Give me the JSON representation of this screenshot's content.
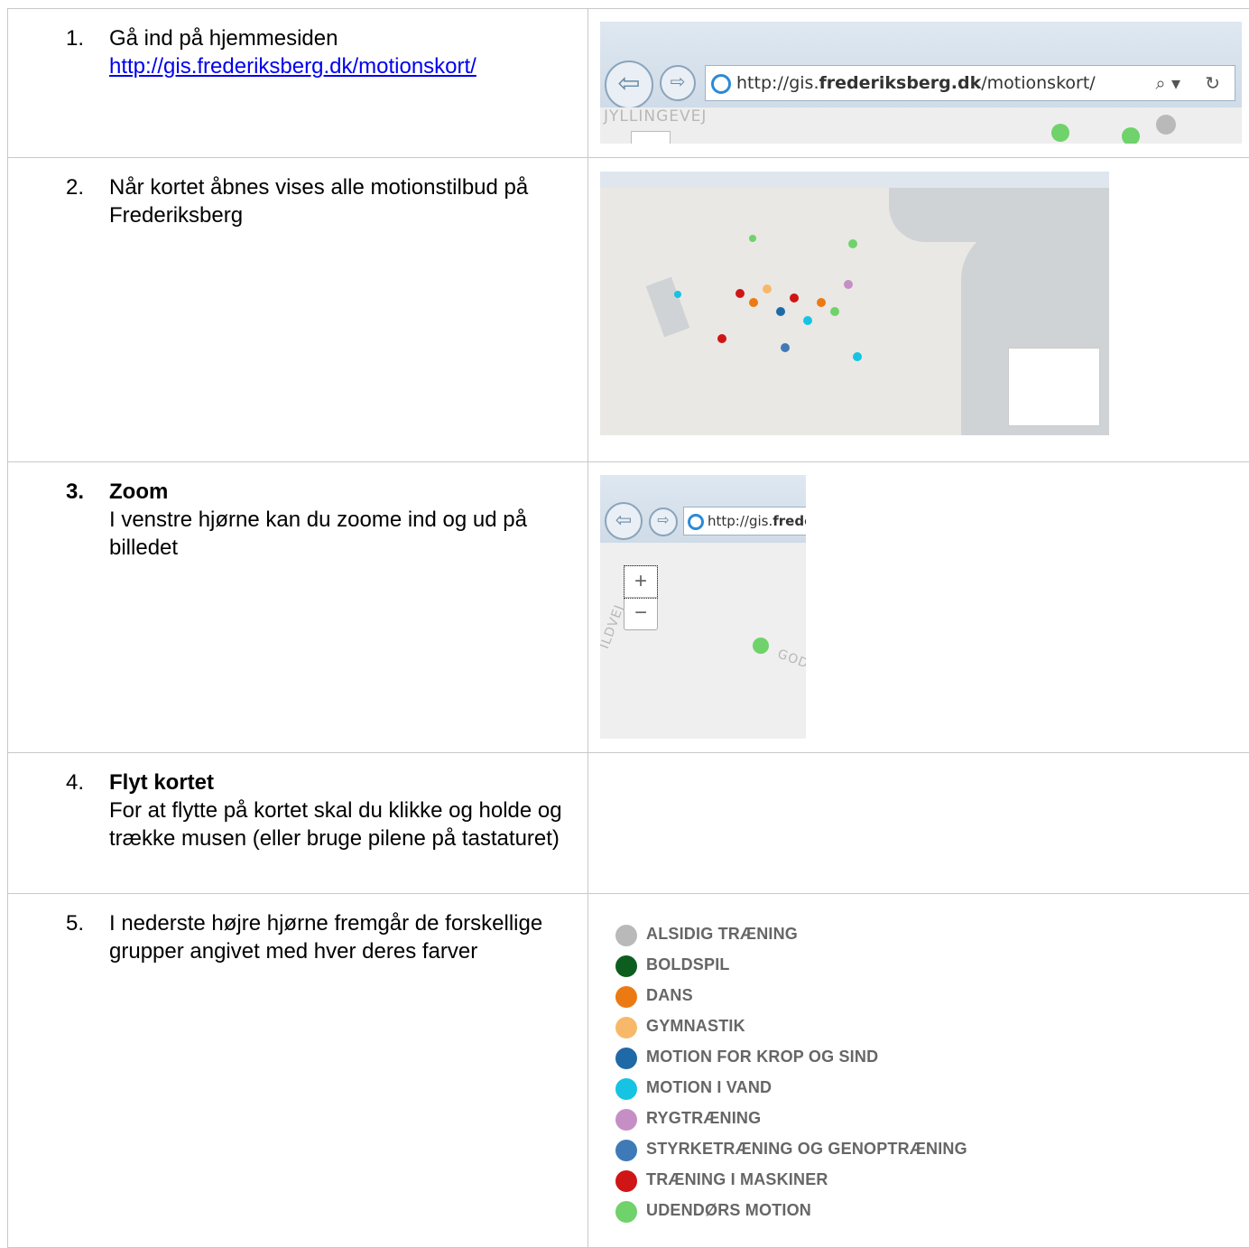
{
  "steps": [
    {
      "number": "1.",
      "text": "Gå ind på hjemmesiden",
      "link": "http://gis.frederiksberg.dk/motionskort/"
    },
    {
      "number": "2.",
      "text": "Når kortet åbnes vises alle motionstilbud på Frederiksberg"
    },
    {
      "number": "3.",
      "title": "Zoom",
      "text": "I venstre hjørne kan du zoome ind og ud på billedet"
    },
    {
      "number": "4.",
      "title": "Flyt kortet",
      "text": "For at flytte på kortet skal du klikke og holde og trække musen (eller bruge pilene på tastaturet)"
    },
    {
      "number": "5.",
      "text": "I nederste højre hjørne fremgår de forskellige grupper angivet med hver deres farver"
    }
  ],
  "screenshot1": {
    "address_prefix": "http://gis.",
    "address_bold": "frederiksberg.dk",
    "address_suffix": "/motionskort/",
    "street_label": "JYLLINGEVEJ",
    "search_icon": "search-icon",
    "refresh_icon": "refresh-icon"
  },
  "screenshot3": {
    "address_prefix": "http://gis.",
    "address_bold": "frede",
    "zoom_in": "+",
    "zoom_out": "−",
    "street_label_left": "ILDVEJ",
    "street_label_right": "GOD"
  },
  "legend": [
    {
      "label": "ALSIDIG TRÆNING",
      "color": "#b9b9b9"
    },
    {
      "label": "BOLDSPIL",
      "color": "#0d5e1e"
    },
    {
      "label": "DANS",
      "color": "#ec7a12"
    },
    {
      "label": "GYMNASTIK",
      "color": "#f7b969"
    },
    {
      "label": "MOTION FOR KROP OG SIND",
      "color": "#1f6aa6"
    },
    {
      "label": "MOTION I VAND",
      "color": "#16c3e3"
    },
    {
      "label": "RYGTRÆNING",
      "color": "#c58fc6"
    },
    {
      "label": "STYRKETRÆNING OG GENOPTRÆNING",
      "color": "#3f7ab8"
    },
    {
      "label": "TRÆNING I MASKINER",
      "color": "#cf1515"
    },
    {
      "label": "UDENDØRS MOTION",
      "color": "#6fd26a"
    }
  ]
}
